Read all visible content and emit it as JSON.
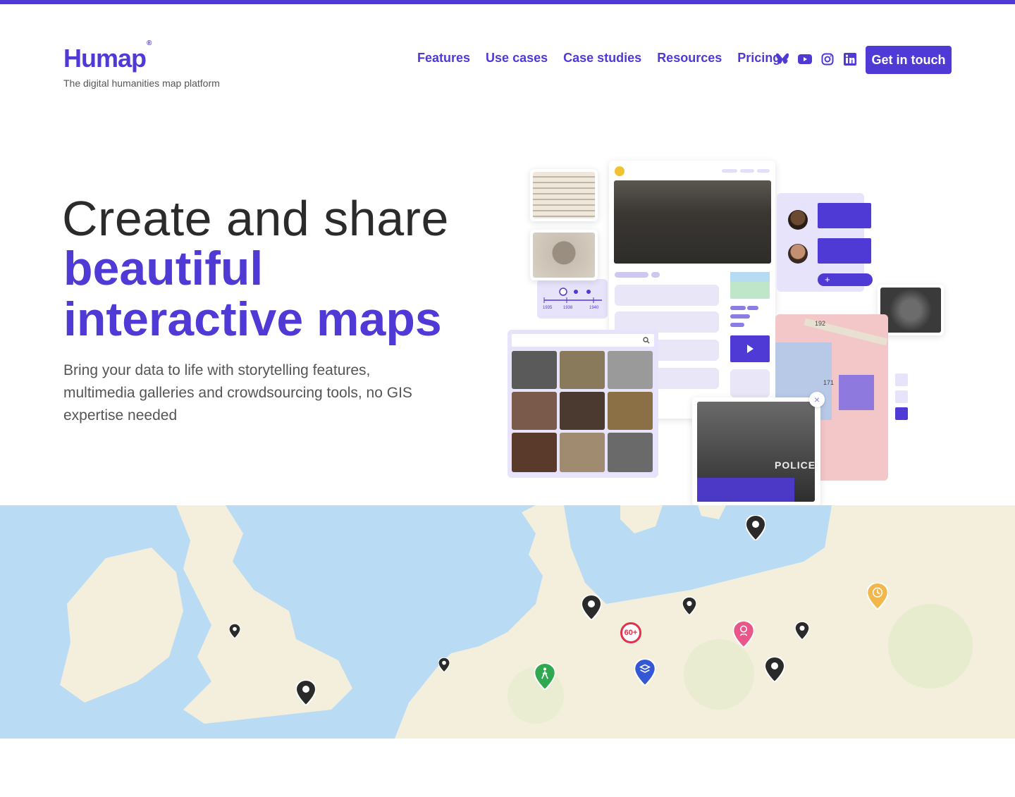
{
  "brand": {
    "logo_text": "Humap",
    "logo_mark": "®",
    "tagline": "The digital humanities map platform",
    "accent": "#4f3ad6"
  },
  "nav": {
    "items": [
      "Features",
      "Use cases",
      "Case studies",
      "Resources",
      "Pricing"
    ],
    "social_icons": [
      "bluesky-icon",
      "youtube-icon",
      "instagram-icon",
      "linkedin-icon"
    ],
    "cta": "Get in touch"
  },
  "hero": {
    "line1": "Create and share",
    "line2": "beautiful",
    "line3": "interactive maps",
    "lead": "Bring your data to life with storytelling features, multimedia galleries and crowdsourcing tools, no GIS expertise needed"
  },
  "illustration": {
    "timeline_years": [
      "1935",
      "1938",
      "1940"
    ],
    "police_sign": "POLICE",
    "map_labels": [
      "192",
      "171"
    ],
    "cluster_badge": "60+"
  }
}
